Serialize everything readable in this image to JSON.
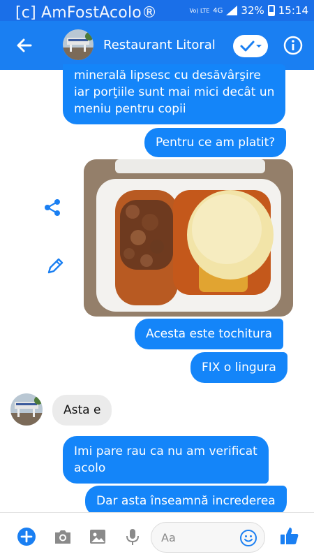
{
  "status_bar": {
    "watermark": "[c] AmFostAcolo®",
    "volte": "Vo) LTE",
    "network": "4G",
    "battery": "32%",
    "time": "15:14"
  },
  "header": {
    "title": "Restaurant Litoral",
    "accent": "#1a7ff2"
  },
  "messages": [
    {
      "text_lines": [
        "minerală lipsesc cu desăvârşire",
        "iar porţiile sunt mai mici decât un",
        "meniu pentru copii"
      ],
      "direction": "out"
    },
    {
      "text": "Pentru ce am platit?",
      "direction": "out"
    },
    {
      "text": "Acesta este tochitura",
      "direction": "out"
    },
    {
      "text": "FIX o lingura",
      "direction": "out"
    },
    {
      "text": "Asta e",
      "direction": "in"
    },
    {
      "text_lines": [
        "Imi pare rau ca nu am verificat",
        "acolo"
      ],
      "direction": "out"
    },
    {
      "text": "Dar asta înseamnă increderea",
      "direction": "out"
    }
  ],
  "composer": {
    "placeholder": "Aa"
  },
  "icons": [
    "back-arrow-icon",
    "check-icon",
    "chevron-down-icon",
    "info-icon",
    "share-icon",
    "edit-pencil-icon",
    "plus-icon",
    "camera-icon",
    "image-icon",
    "microphone-icon",
    "emoji-icon",
    "thumbs-up-icon"
  ]
}
